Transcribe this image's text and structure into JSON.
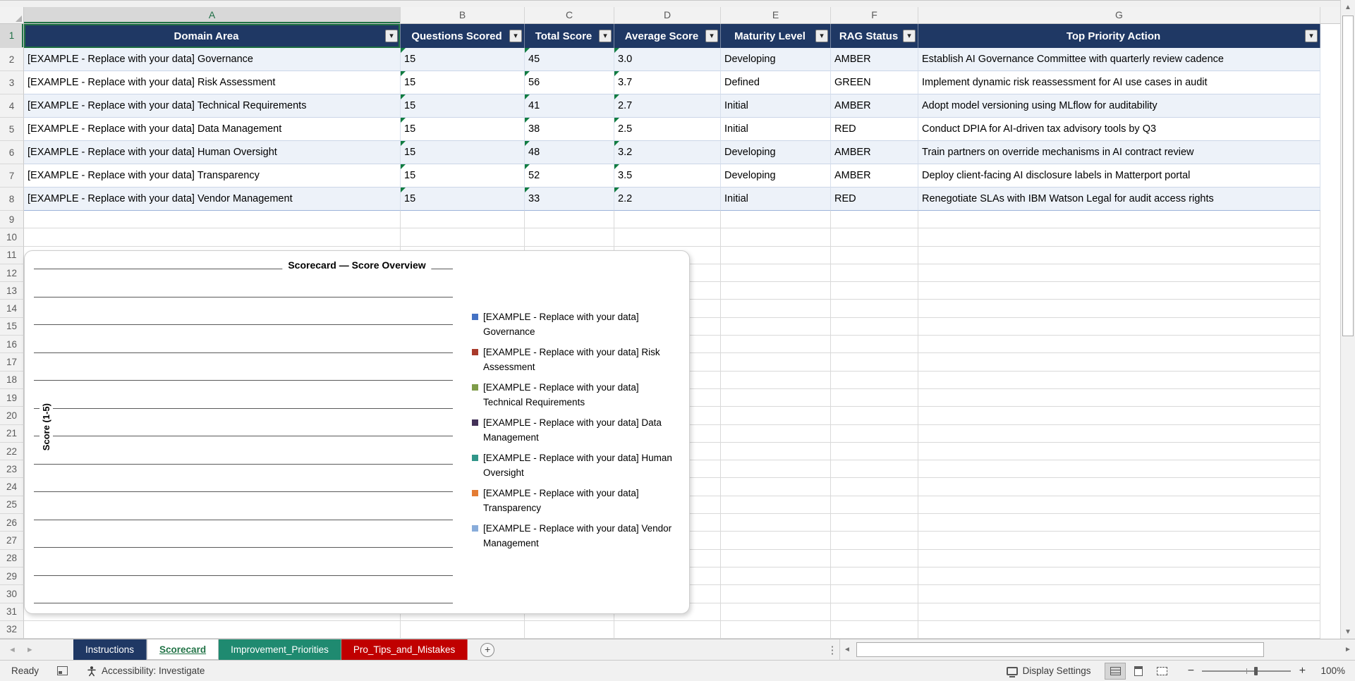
{
  "app": {
    "name": "Excel spreadsheet",
    "selection": "A1"
  },
  "columns": [
    "A",
    "B",
    "C",
    "D",
    "E",
    "F",
    "G"
  ],
  "row_count": 32,
  "table": {
    "headers": [
      "Domain Area",
      "Questions Scored",
      "Total Score",
      "Average Score",
      "Maturity Level",
      "RAG Status",
      "Top Priority Action"
    ],
    "rows": [
      [
        "[EXAMPLE - Replace with your data] Governance",
        "15",
        "45",
        "3.0",
        "Developing",
        "AMBER",
        "Establish AI Governance Committee with quarterly review cadence"
      ],
      [
        "[EXAMPLE - Replace with your data] Risk Assessment",
        "15",
        "56",
        "3.7",
        "Defined",
        "GREEN",
        "Implement dynamic risk reassessment for AI use cases in audit"
      ],
      [
        "[EXAMPLE - Replace with your data] Technical Requirements",
        "15",
        "41",
        "2.7",
        "Initial",
        "AMBER",
        "Adopt model versioning using MLflow for auditability"
      ],
      [
        "[EXAMPLE - Replace with your data] Data Management",
        "15",
        "38",
        "2.5",
        "Initial",
        "RED",
        "Conduct DPIA for AI-driven tax advisory tools by Q3"
      ],
      [
        "[EXAMPLE - Replace with your data] Human Oversight",
        "15",
        "48",
        "3.2",
        "Developing",
        "AMBER",
        "Train partners on override mechanisms in AI contract review"
      ],
      [
        "[EXAMPLE - Replace with your data] Transparency",
        "15",
        "52",
        "3.5",
        "Developing",
        "AMBER",
        "Deploy client-facing AI disclosure labels in Matterport portal"
      ],
      [
        "[EXAMPLE - Replace with your data] Vendor Management",
        "15",
        "33",
        "2.2",
        "Initial",
        "RED",
        "Renegotiate SLAs with IBM Watson Legal for audit access rights"
      ]
    ],
    "header_color": "#1F3864",
    "band_color": "#EDF2F9"
  },
  "chart": {
    "title": "Scorecard — Score Overview",
    "y_axis_label": "Score (1-5)",
    "legend": [
      {
        "label": "[EXAMPLE - Replace with your data] Governance",
        "color": "#4472C4"
      },
      {
        "label": "[EXAMPLE - Replace with your data] Risk Assessment",
        "color": "#A93A2B"
      },
      {
        "label": "[EXAMPLE - Replace with your data] Technical Requirements",
        "color": "#7E9C49"
      },
      {
        "label": "[EXAMPLE - Replace with your data] Data Management",
        "color": "#433158"
      },
      {
        "label": "[EXAMPLE - Replace with your data] Human Oversight",
        "color": "#319689"
      },
      {
        "label": "[EXAMPLE - Replace with your data] Transparency",
        "color": "#E47C33"
      },
      {
        "label": "[EXAMPLE - Replace with your data] Vendor Management",
        "color": "#88ACDA"
      }
    ]
  },
  "chart_data": {
    "type": "bar",
    "title": "Scorecard — Score Overview",
    "ylabel": "Score (1-5)",
    "categories": [],
    "series": [
      {
        "name": "[EXAMPLE - Replace with your data] Governance",
        "values": []
      },
      {
        "name": "[EXAMPLE - Replace with your data] Risk Assessment",
        "values": []
      },
      {
        "name": "[EXAMPLE - Replace with your data] Technical Requirements",
        "values": []
      },
      {
        "name": "[EXAMPLE - Replace with your data] Data Management",
        "values": []
      },
      {
        "name": "[EXAMPLE - Replace with your data] Human Oversight",
        "values": []
      },
      {
        "name": "[EXAMPLE - Replace with your data] Transparency",
        "values": []
      },
      {
        "name": "[EXAMPLE - Replace with your data] Vendor Management",
        "values": []
      }
    ],
    "legend_position": "right",
    "grid": true,
    "plot_area_empty": true
  },
  "sheet_tabs": {
    "tabs": [
      {
        "label": "Instructions",
        "color": "#1F3864",
        "active": false
      },
      {
        "label": "Scorecard",
        "color": "#217346",
        "active": true
      },
      {
        "label": "Improvement_Priorities",
        "color": "#1F8A70",
        "active": false
      },
      {
        "label": "Pro_Tips_and_Mistakes",
        "color": "#C00000",
        "active": false
      }
    ]
  },
  "status_bar": {
    "ready": "Ready",
    "accessibility": "Accessibility: Investigate",
    "display_settings": "Display Settings",
    "zoom_out": "−",
    "zoom_in": "+",
    "zoom_level": "100%"
  },
  "icons": {
    "dropdown": "▾",
    "up_arrow": "▲",
    "down_arrow": "▼",
    "left_arrow": "◄",
    "right_arrow": "►",
    "add_sheet": "+",
    "splitter_dots": "⋮"
  }
}
